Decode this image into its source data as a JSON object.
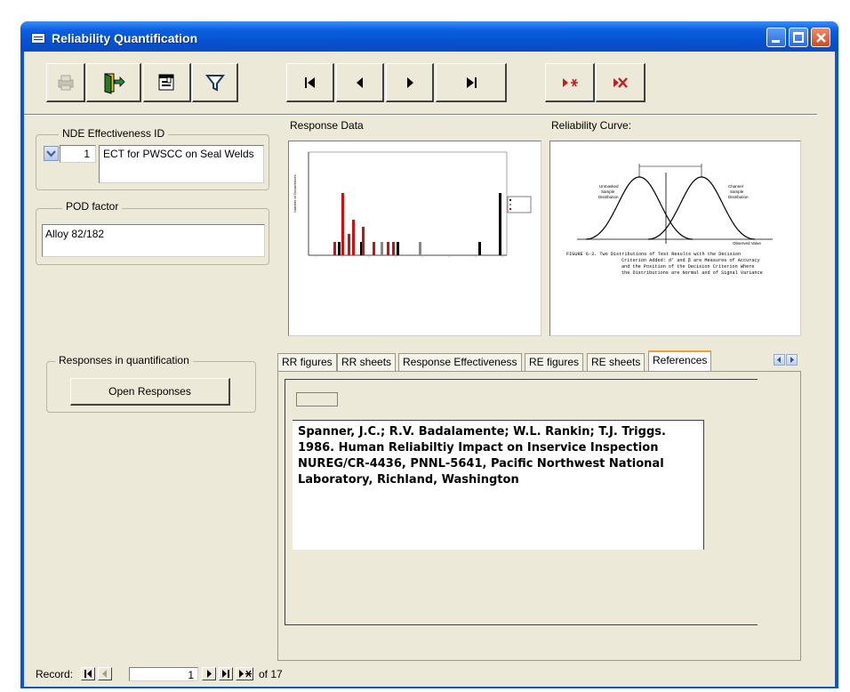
{
  "window": {
    "title": "Reliability Quantification"
  },
  "toolbar": {
    "buttons": [
      "print-icon",
      "exit-door-icon",
      "form-view-icon",
      "filter-icon",
      "first-record-icon",
      "prev-record-icon",
      "next-record-icon",
      "last-record-icon",
      "new-record-icon",
      "delete-record-icon"
    ]
  },
  "nde_group": {
    "legend": "NDE Effectiveness ID",
    "id_value": "1",
    "name_value": "ECT for PWSCC on Seal Welds"
  },
  "pod_group": {
    "legend": "POD factor",
    "value": "Alloy 82/182"
  },
  "response_data": {
    "label": "Response Data"
  },
  "reliability_curve": {
    "label": "Reliability Curve:",
    "caption_lines": [
      "FIGURE 6-3.   Two Distributions of Test Results with the Decision",
      "Criterion Added:  d' and β are Measures of Accuracy",
      "and the Position of the Decision Criterion Where",
      "the Distributions are Normal and of Signal Variance"
    ],
    "left_label": [
      "Unmasked",
      "Sample",
      "Distribution"
    ],
    "right_label": [
      "Channel",
      "Sample",
      "Distribution"
    ],
    "axis_label": "Observed Value"
  },
  "responses_group": {
    "legend": "Responses in quantification",
    "button": "Open Responses"
  },
  "tabs": [
    "RR figures",
    "RR sheets",
    "Response Effectiveness",
    "RE figures",
    "RE sheets",
    "References"
  ],
  "active_tab": "References",
  "reference_text": "Spanner, J.C.; R.V. Badalamente; W.L. Rankin; T.J. Triggs. 1986. Human Reliabiltiy Impact on Inservice Inspection NUREG/CR-4436, PNNL-5641, Pacific Northwest National Laboratory, Richland, Washington",
  "record_nav": {
    "label": "Record:",
    "current": "1",
    "total_text": "of 17"
  }
}
